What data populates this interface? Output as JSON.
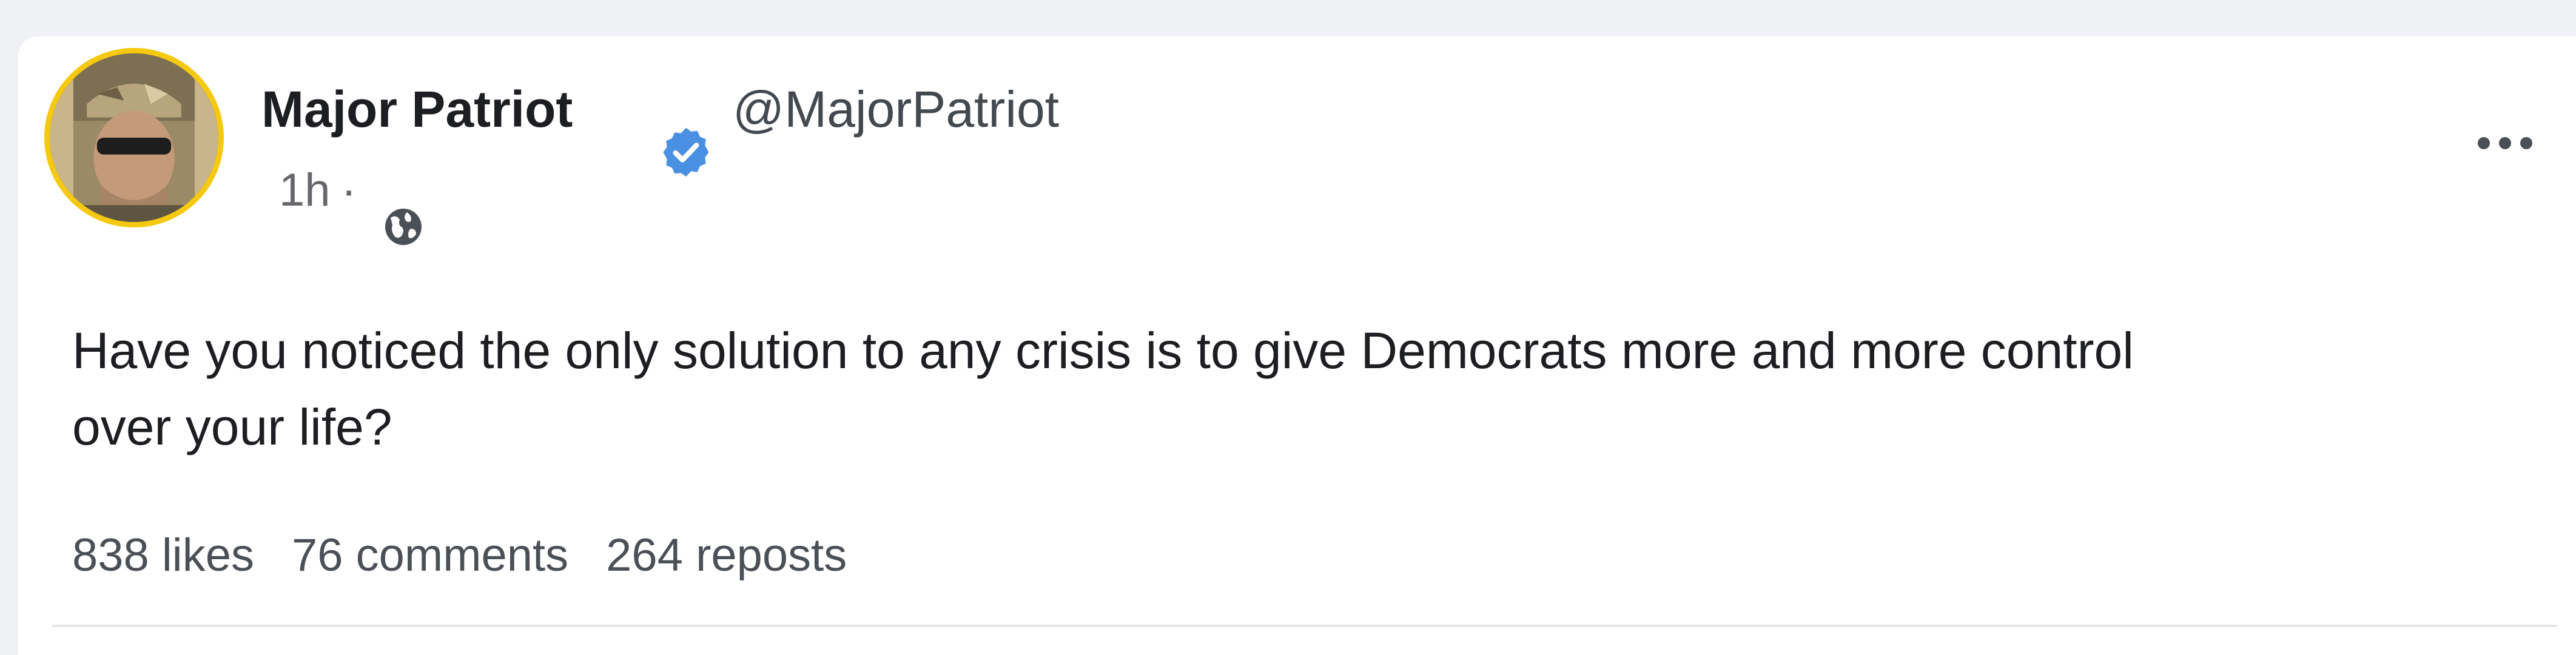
{
  "post": {
    "author_name": "Major Patriot",
    "verified": true,
    "handle": "@MajorPatriot",
    "time": "1h",
    "separator": "·",
    "visibility_icon": "globe-icon",
    "text": "Have you noticed the only solution to any crisis is to give Democrats more and more control\nover your life?",
    "stats": {
      "likes": "838 likes",
      "comments": "76 comments",
      "reposts": "264 reposts"
    },
    "menu_icon": "more-options-icon"
  },
  "colors": {
    "page_bg": "#eff1f5",
    "card_bg": "#ffffff",
    "avatar_ring": "#f4c90f",
    "verified_badge": "#4a90e2",
    "text_primary": "#1c1e21",
    "text_secondary": "#65676b"
  }
}
